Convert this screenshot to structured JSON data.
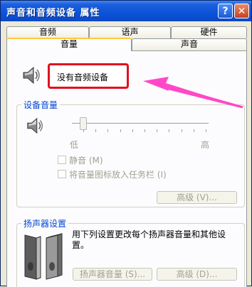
{
  "window": {
    "title": "声音和音频设备 属性",
    "help_button": "?",
    "close_button": "✕"
  },
  "tabs": {
    "row1": [
      "音频",
      "语声",
      "硬件"
    ],
    "row2": [
      "音量",
      "声音"
    ],
    "active": "音量"
  },
  "volume_tab": {
    "status_text": "没有音频设备",
    "device_volume": {
      "title": "设备音量",
      "low_label": "低",
      "high_label": "高",
      "level": 0.08,
      "mute_label": "静音 (M)",
      "taskbar_label": "将音量图标放入任务栏 (I)",
      "advanced_button": "高级 (V)..."
    },
    "speaker_settings": {
      "title": "扬声器设置",
      "description": "用下列设置更改每个扬声器音量和其他设置。",
      "speaker_volume_button": "扬声器音量 (S)...",
      "advanced_button": "高级 (D)..."
    }
  },
  "colors": {
    "title_bar": "#0b53d9",
    "highlight_box": "#e0101e",
    "annotation_arrow": "#ff48c8",
    "group_title": "#0046d5"
  },
  "icons": [
    "help-icon",
    "close-icon",
    "speaker-icon",
    "speaker-pair-icon",
    "annotation-arrow"
  ]
}
